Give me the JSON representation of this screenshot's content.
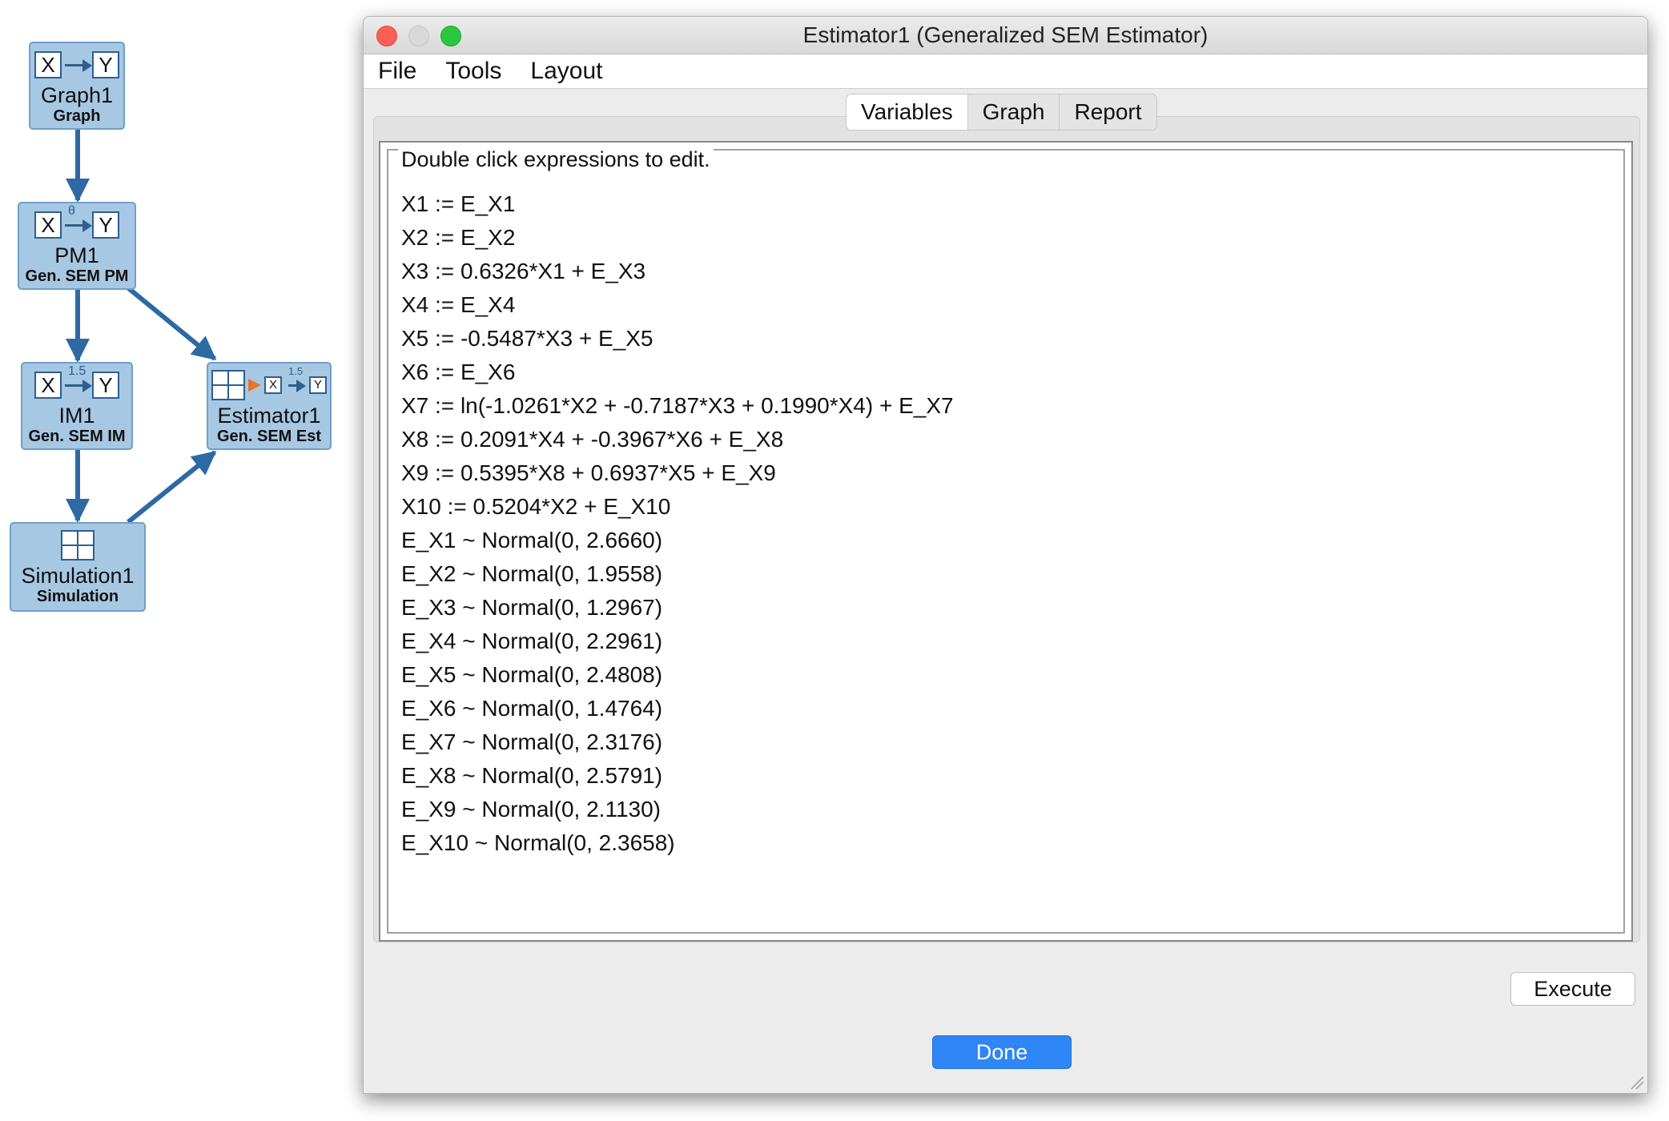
{
  "workflow": {
    "nodes": [
      {
        "title": "Graph1",
        "subtitle": "Graph",
        "edge_label": ""
      },
      {
        "title": "PM1",
        "subtitle": "Gen. SEM PM",
        "edge_label": "θ"
      },
      {
        "title": "IM1",
        "subtitle": "Gen. SEM IM",
        "edge_label": "1.5"
      },
      {
        "title": "Estimator1",
        "subtitle": "Gen. SEM Est",
        "edge_label": "1.5"
      },
      {
        "title": "Simulation1",
        "subtitle": "Simulation",
        "edge_label": ""
      }
    ],
    "box_letters": {
      "x": "X",
      "y": "Y"
    },
    "edge_color": "#2d6aa3",
    "node_color": "#a7c8e3",
    "estimator_arrow_color": "#e8742b"
  },
  "window": {
    "title": "Estimator1 (Generalized SEM Estimator)",
    "traffic_lights": {
      "close": "#fc5f57",
      "minimize": "#d9d9d9",
      "zoom": "#2ac840"
    }
  },
  "menu": {
    "items": [
      "File",
      "Tools",
      "Layout"
    ]
  },
  "tabs": {
    "items": [
      "Variables",
      "Graph",
      "Report"
    ],
    "active": "Variables"
  },
  "panel": {
    "header": "Double click expressions to edit.",
    "expressions": [
      "X1 := E_X1",
      "X2 := E_X2",
      "X3 := 0.6326*X1 + E_X3",
      "X4 := E_X4",
      "X5 := -0.5487*X3 + E_X5",
      "X6 := E_X6",
      "X7 := ln(-1.0261*X2 + -0.7187*X3 + 0.1990*X4) + E_X7",
      "X8 := 0.2091*X4 + -0.3967*X6 + E_X8",
      "X9 := 0.5395*X8 + 0.6937*X5 + E_X9",
      "X10 := 0.5204*X2 + E_X10",
      "E_X1 ~ Normal(0, 2.6660)",
      "E_X2 ~ Normal(0, 1.9558)",
      "E_X3 ~ Normal(0, 1.2967)",
      "E_X4 ~ Normal(0, 2.2961)",
      "E_X5 ~ Normal(0, 2.4808)",
      "E_X6 ~ Normal(0, 1.4764)",
      "E_X7 ~ Normal(0, 2.3176)",
      "E_X8 ~ Normal(0, 2.5791)",
      "E_X9 ~ Normal(0, 2.1130)",
      "E_X10 ~ Normal(0, 2.3658)"
    ]
  },
  "buttons": {
    "execute": "Execute",
    "done": "Done"
  },
  "accent": "#2f86f6"
}
